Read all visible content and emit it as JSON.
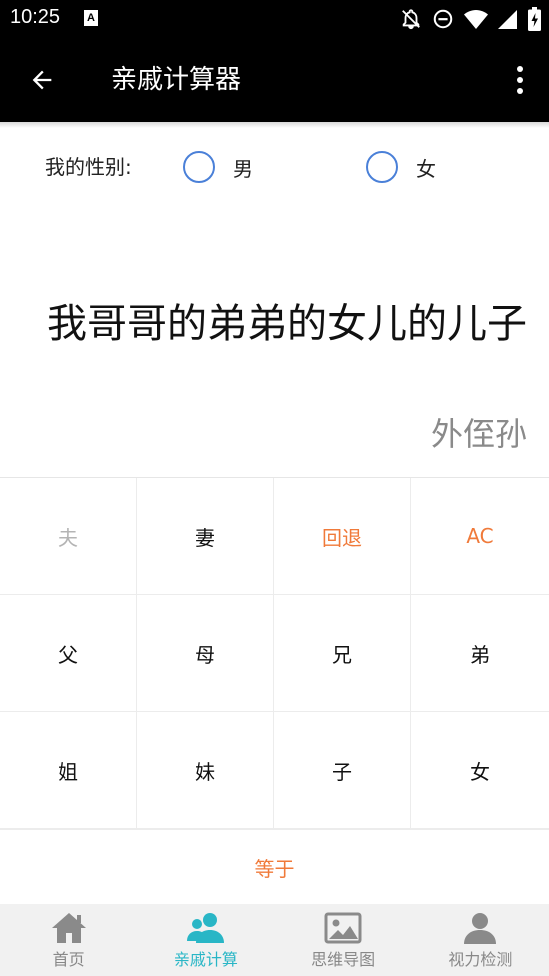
{
  "status_bar": {
    "time": "10:25",
    "app_icon_letter": "A",
    "icons": [
      "notifications-off-icon",
      "do-not-disturb-icon",
      "wifi-icon",
      "signal-icon",
      "battery-charging-icon"
    ]
  },
  "toolbar": {
    "title": "亲戚计算器",
    "back_icon": "arrow-left-icon",
    "menu_icon": "more-vert-icon"
  },
  "gender": {
    "label": "我的性别:",
    "options": [
      {
        "label": "男",
        "selected": false
      },
      {
        "label": "女",
        "selected": false
      }
    ]
  },
  "display": {
    "expression": "我哥哥的弟弟的女儿的儿子",
    "result": "外侄孙"
  },
  "keypad": {
    "rows": [
      [
        {
          "label": "夫",
          "state": "disabled"
        },
        {
          "label": "妻",
          "state": "normal"
        },
        {
          "label": "回退",
          "state": "accent"
        },
        {
          "label": "AC",
          "state": "accent"
        }
      ],
      [
        {
          "label": "父",
          "state": "normal"
        },
        {
          "label": "母",
          "state": "normal"
        },
        {
          "label": "兄",
          "state": "normal"
        },
        {
          "label": "弟",
          "state": "normal"
        }
      ],
      [
        {
          "label": "姐",
          "state": "normal"
        },
        {
          "label": "妹",
          "state": "normal"
        },
        {
          "label": "子",
          "state": "normal"
        },
        {
          "label": "女",
          "state": "normal"
        }
      ]
    ],
    "equals": "等于"
  },
  "bottom_nav": {
    "items": [
      {
        "label": "首页",
        "icon": "home-icon",
        "active": false
      },
      {
        "label": "亲戚计算",
        "icon": "people-icon",
        "active": true
      },
      {
        "label": "思维导图",
        "icon": "image-icon",
        "active": false
      },
      {
        "label": "视力检测",
        "icon": "person-icon",
        "active": false
      }
    ]
  },
  "colors": {
    "accent": "#f07a3a",
    "active_nav": "#29b6c6",
    "radio": "#4a80d8"
  }
}
